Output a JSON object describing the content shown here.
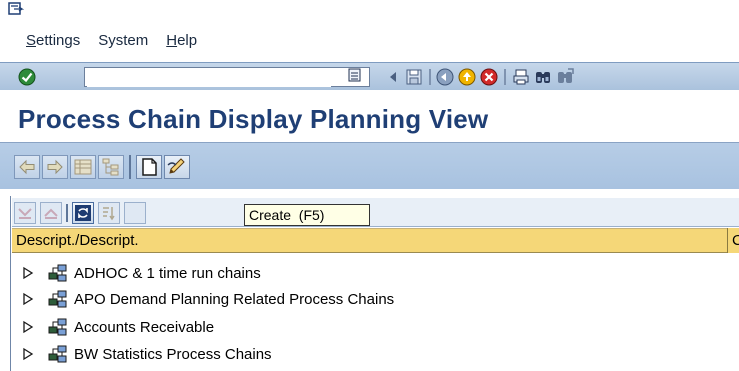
{
  "menu": {
    "items": [
      {
        "label": "Settings",
        "underline": "S",
        "rest": "ettings"
      },
      {
        "label": "System",
        "underline": "",
        "rest": "System"
      },
      {
        "label": "Help",
        "underline": "H",
        "rest": "elp"
      }
    ]
  },
  "toolbar": {
    "command_value": ""
  },
  "title": "Process Chain Display Planning View",
  "tooltip": "Create  (F5)",
  "tree": {
    "column_header": "Descript./Descript.",
    "column_header_2": "C",
    "rows": [
      {
        "label": "ADHOC & 1 time run chains"
      },
      {
        "label": "APO Demand Planning Related Process Chains"
      },
      {
        "label": "Accounts Receivable"
      },
      {
        "label": "BW Statistics Process Chains"
      }
    ]
  },
  "colors": {
    "title": "#1f3f75",
    "column_header_bg": "#f5d778",
    "toolbar_bg": "#a8c2e0"
  }
}
